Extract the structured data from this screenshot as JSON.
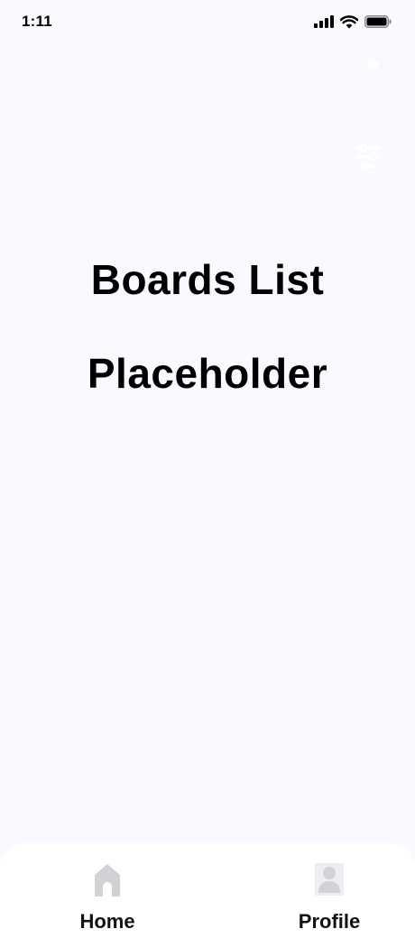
{
  "status_bar": {
    "time": "1:11"
  },
  "icons": {
    "signal": "cellular-signal-icon",
    "wifi": "wifi-icon",
    "battery": "battery-icon",
    "filter": "sliders-filter-icon",
    "home": "home-icon",
    "profile": "person-icon"
  },
  "main": {
    "title_line1": "Boards List",
    "title_line2": "Placeholder"
  },
  "bottom_nav": {
    "items": [
      {
        "label": "Home"
      },
      {
        "label": "Profile"
      }
    ]
  },
  "colors": {
    "background": "#f9faff",
    "nav_background": "#ffffff",
    "nav_icon": "#d2d2d6",
    "text": "#000000"
  }
}
